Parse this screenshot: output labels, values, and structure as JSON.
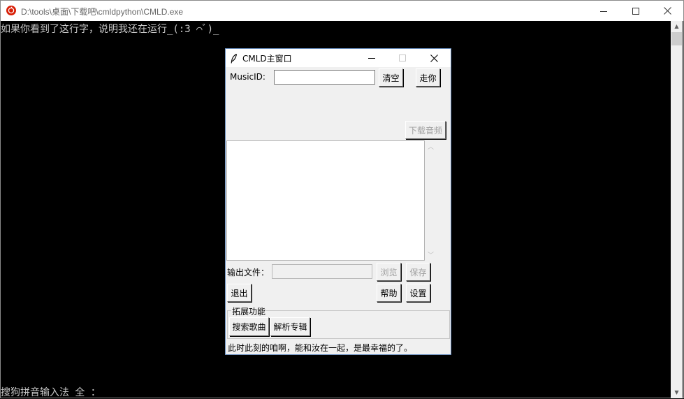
{
  "console": {
    "title": "D:\\tools\\桌面\\下载吧\\cmldpython\\CMLD.exe",
    "line1": "如果你看到了这行字，说明我还在运行_(:3 ⌒ﾞ)_",
    "ime_status": "搜狗拼音输入法 全 ："
  },
  "window": {
    "title": "CMLD主窗口",
    "musicid_label": "MusicID:",
    "musicid_value": "",
    "clear_button": "清空",
    "go_button": "走你",
    "download_button": "下载音频",
    "output_label": "输出文件：",
    "output_value": "",
    "browse_button": "浏览",
    "save_button": "保存",
    "exit_button": "退出",
    "help_button": "帮助",
    "settings_button": "设置",
    "extension_group_label": "拓展功能",
    "search_song_button": "搜索歌曲",
    "parse_album_button": "解析专辑",
    "status_text": "此时此刻的咱啊，能和汝在一起，是最幸福的了。"
  },
  "icons": {
    "console_app": "netease-music-icon",
    "tk_window": "feather-icon"
  },
  "colors": {
    "console_bg": "#000000",
    "console_text": "#c8c8c8",
    "window_bg": "#f0f0f0",
    "app_icon_red": "#d81e06"
  }
}
